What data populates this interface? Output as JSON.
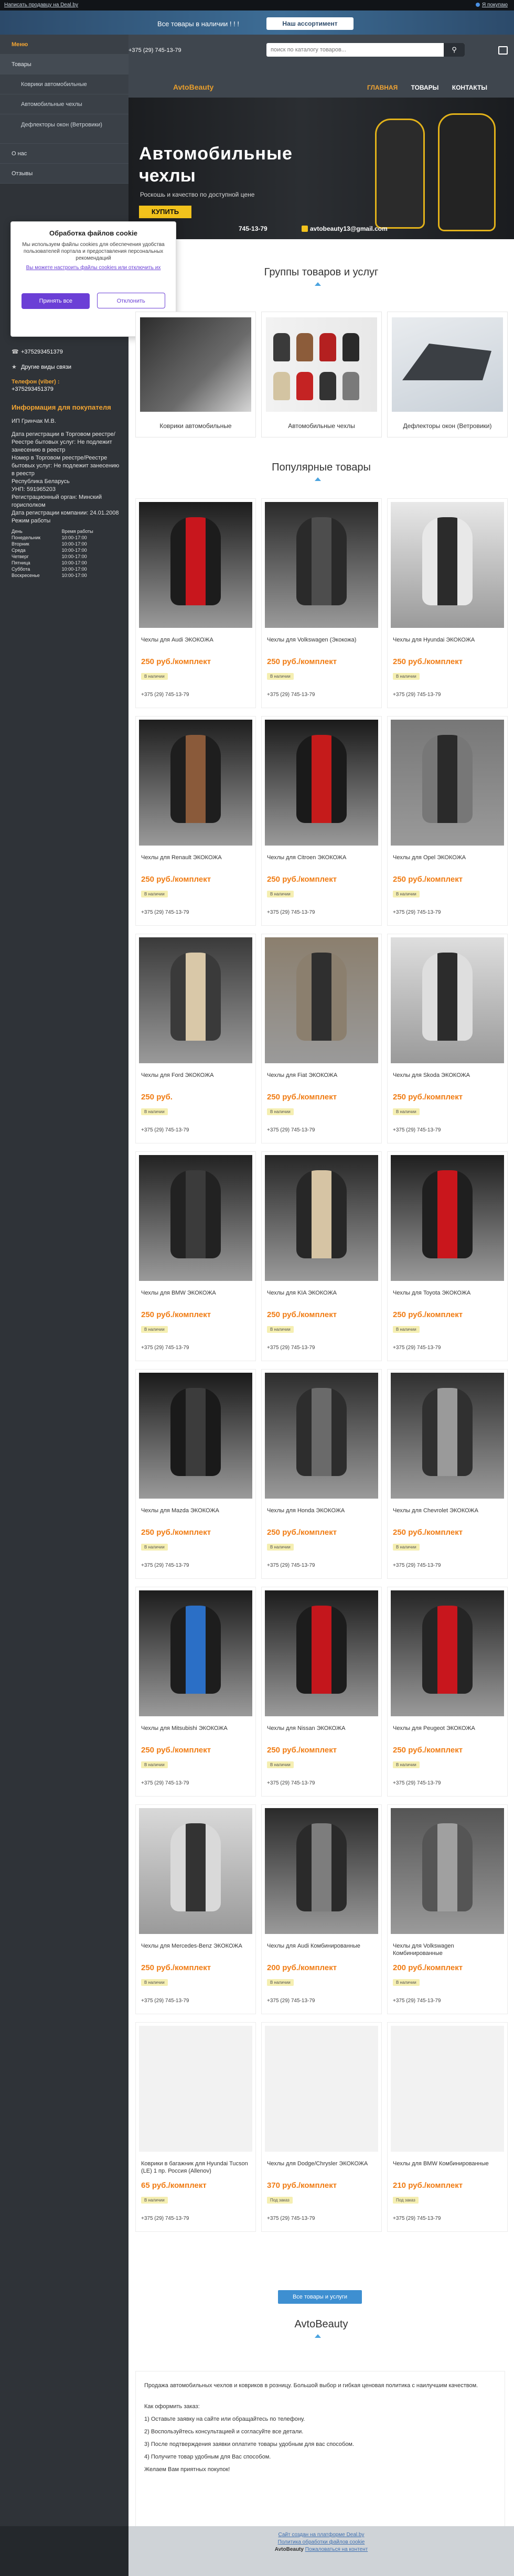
{
  "topbar": {
    "left_link": "Написать продавцу на Deal.by",
    "right_link": "Я покупаю"
  },
  "announce": {
    "text": "Все товары в наличии ! ! !",
    "button": "Наш ассортимент"
  },
  "header": {
    "phone": "+375 (29) 745-13-79",
    "logo_prefix": "Avto",
    "logo_suffix": "Beauty",
    "search_placeholder": "поиск по каталогу товаров...",
    "nav": [
      "ГЛАВНАЯ",
      "ТОВАРЫ",
      "КОНТАКТЫ"
    ]
  },
  "sidebar": {
    "menu": [
      {
        "label": "Меню",
        "cls": "hd"
      },
      {
        "label": "Товары",
        "cls": "hl"
      },
      {
        "label": "Коврики автомобильные",
        "cls": "sub"
      },
      {
        "label": "Автомобильные чехлы",
        "cls": "sub"
      },
      {
        "label": "Дефлекторы окон (Ветровики)",
        "cls": "sub"
      },
      {
        "label": "О нас",
        "cls": ""
      },
      {
        "label": "Отзывы",
        "cls": ""
      }
    ],
    "contacts": {
      "phone1": "+375293451379",
      "other": "Другие виды связи",
      "viber_label": "Телефон (viber) :",
      "phone2": "+375293451379",
      "info_title": "Информация для покупателя",
      "seller": "ИП Гринчак М.В.",
      "reg_text": "Дата регистрации в Торговом реестре/Реестре бытовых услуг: Не подлежит занесению в реестр",
      "reg_num": "Номер в Торговом реестре/Реестре бытовых услуг: Не подлежит занесению в реестр",
      "country": "Республика Беларусь",
      "unp": "УНП: 591965203",
      "reg_org": "Регистрационный орган: Минский горисполком",
      "reg_date": "Дата регистрации компании: 24.01.2008",
      "hours_title": "Режим работы",
      "hours_head": [
        "День",
        "Время работы"
      ],
      "hours": [
        [
          "Понедельник",
          "10:00-17:00"
        ],
        [
          "Вторник",
          "10:00-17:00"
        ],
        [
          "Среда",
          "10:00-17:00"
        ],
        [
          "Четверг",
          "10:00-17:00"
        ],
        [
          "Пятница",
          "10:00-17:00"
        ],
        [
          "Суббота",
          "10:00-17:00"
        ],
        [
          "Воскресенье",
          "10:00-17:00"
        ]
      ]
    }
  },
  "cookie": {
    "title": "Обработка файлов cookie",
    "text": "Мы используем файлы cookies для обеспечения удобства пользователей портала и предоставления персональных рекомендаций",
    "link": "Вы можете настроить файлы cookies или отключить их",
    "accept": "Принять все",
    "decline": "Отклонить"
  },
  "banner": {
    "title1": "Автомобильные",
    "title2": "чехлы",
    "subtitle": "Роскошь и качество по доступной цене",
    "button": "КУПИТЬ",
    "phone": "745-13-79",
    "email": "avtobeauty13@gmail.com"
  },
  "groups": {
    "title": "Группы товаров и услуг",
    "items": [
      "Коврики автомобильные",
      "Автомобильные чехлы",
      "Дефлекторы окон (Ветровики)"
    ]
  },
  "popular": {
    "title": "Популярные товары",
    "phone": "+375 (29) 745-13-79",
    "products": [
      {
        "name": "Чехлы для Audi ЭКОКОЖА",
        "price": "250 руб./комплект",
        "stock": "В наличии",
        "c1": "#1c1c1c",
        "c2": "#c8161d"
      },
      {
        "name": "Чехлы для Volkswagen (Экокожа)",
        "price": "250 руб./комплект",
        "stock": "В наличии",
        "c1": "#2a2a2a",
        "c2": "#4d4d4d"
      },
      {
        "name": "Чехлы для Hyundai ЭКОКОЖА",
        "price": "250 руб./комплект",
        "stock": "В наличии",
        "c1": "#e8e8e8",
        "c2": "#2b2b2b"
      },
      {
        "name": "Чехлы для Renault ЭКОКОЖА",
        "price": "250 руб./комплект",
        "stock": "В наличии",
        "c1": "#1e1e1e",
        "c2": "#8a5a3a"
      },
      {
        "name": "Чехлы для Citroen ЭКОКОЖА",
        "price": "250 руб./комплект",
        "stock": "В наличии",
        "c1": "#1a1a1a",
        "c2": "#c51b1b"
      },
      {
        "name": "Чехлы для Opel ЭКОКОЖА",
        "price": "250 руб./комплект",
        "stock": "В наличии",
        "c1": "#777777",
        "c2": "#2a2a2a"
      },
      {
        "name": "Чехлы для Ford ЭКОКОЖА",
        "price": "250 руб.",
        "stock": "В наличии",
        "c1": "#3a3a3a",
        "c2": "#d9c8a8"
      },
      {
        "name": "Чехлы для Fiat ЭКОКОЖА",
        "price": "250 руб./комплект",
        "stock": "В наличии",
        "c1": "#8b7f6e",
        "c2": "#2f2f2f"
      },
      {
        "name": "Чехлы для Skoda ЭКОКОЖА",
        "price": "250 руб./комплект",
        "stock": "В наличии",
        "c1": "#dedede",
        "c2": "#2c2c2c"
      },
      {
        "name": "Чехлы для BMW ЭКОКОЖА",
        "price": "250 руб./комплект",
        "stock": "В наличии",
        "c1": "#222222",
        "c2": "#3b3b3b"
      },
      {
        "name": "Чехлы для KIA ЭКОКОЖА",
        "price": "250 руб./комплект",
        "stock": "В наличии",
        "c1": "#272727",
        "c2": "#d6c4a4"
      },
      {
        "name": "Чехлы для Toyota ЭКОКОЖА",
        "price": "250 руб./комплект",
        "stock": "В наличии",
        "c1": "#1f1f1f",
        "c2": "#c9161c"
      },
      {
        "name": "Чехлы для Mazda ЭКОКОЖА",
        "price": "250 руб./комплект",
        "stock": "В наличии",
        "c1": "#1a1a1a",
        "c2": "#3c3c3c"
      },
      {
        "name": "Чехлы для Honda ЭКОКОЖА",
        "price": "250 руб./комплект",
        "stock": "В наличии",
        "c1": "#2d2d2d",
        "c2": "#6a6a6a"
      },
      {
        "name": "Чехлы для Chevrolet ЭКОКОЖА",
        "price": "250 руб./комплект",
        "stock": "В наличии",
        "c1": "#303030",
        "c2": "#9a9a9a"
      },
      {
        "name": "Чехлы для Mitsubishi ЭКОКОЖА",
        "price": "250 руб./комплект",
        "stock": "В наличии",
        "c1": "#1d1d1d",
        "c2": "#2b6fc6"
      },
      {
        "name": "Чехлы для Nissan ЭКОКОЖА",
        "price": "250 руб./комплект",
        "stock": "В наличии",
        "c1": "#1c1c1c",
        "c2": "#c4161c"
      },
      {
        "name": "Чехлы для Peugeot ЭКОКОЖА",
        "price": "250 руб./комплект",
        "stock": "В наличии",
        "c1": "#252525",
        "c2": "#c8161d"
      },
      {
        "name": "Чехлы для Mercedes-Benz ЭКОКОЖА",
        "price": "250 руб./комплект",
        "stock": "В наличии",
        "c1": "#d9d9d9",
        "c2": "#333333"
      },
      {
        "name": "Чехлы для Audi Комбинированные",
        "price": "200 руб./комплект",
        "stock": "В наличии",
        "c1": "#2a2a2a",
        "c2": "#7d7d7d"
      },
      {
        "name": "Чехлы для Volkswagen Комбинированные",
        "price": "200 руб./комплект",
        "stock": "В наличии",
        "c1": "#555555",
        "c2": "#a0a0a0"
      },
      {
        "name": "Коврики в багажник для Hyundai Tucson (LE) 1 пр. Россия (Allenov)",
        "price": "65 руб./комплект",
        "stock": "В наличии",
        "c1": "#f2f2f2",
        "c2": "#f2f2f2"
      },
      {
        "name": "Чехлы для Dodge/Chrysler ЭКОКОЖА",
        "price": "370 руб./комплект",
        "stock": "Под заказ",
        "c1": "#f2f2f2",
        "c2": "#f2f2f2"
      },
      {
        "name": "Чехлы для BMW Комбинированные",
        "price": "210 руб./комплект",
        "stock": "Под заказ",
        "c1": "#f2f2f2",
        "c2": "#f2f2f2"
      }
    ],
    "all_button": "Все товары и услуги"
  },
  "about": {
    "title": "AvtoBeauty",
    "lines": [
      "Продажа автомобильных чехлов и ковриков в розницу. Большой выбор и гибкая ценовая политика с наилучшим качеством.",
      "Как оформить заказ:",
      "1) Оставьте заявку на сайте или обращайтесь по телефону.",
      "2) Воспользуйтесь консультацией и согласуйте все детали.",
      "3) После подтверждения заявки оплатите товары удобным для вас способом.",
      "4) Получите товар удобным для Вас способом.",
      "Желаем Вам приятных покупок!"
    ]
  },
  "footer": {
    "line1": "Сайт создан на платформе Deal.by",
    "line2": "Политика обработки файлов cookie",
    "brand": "AvtoBeauty",
    "line3": "Пожаловаться на контент"
  }
}
